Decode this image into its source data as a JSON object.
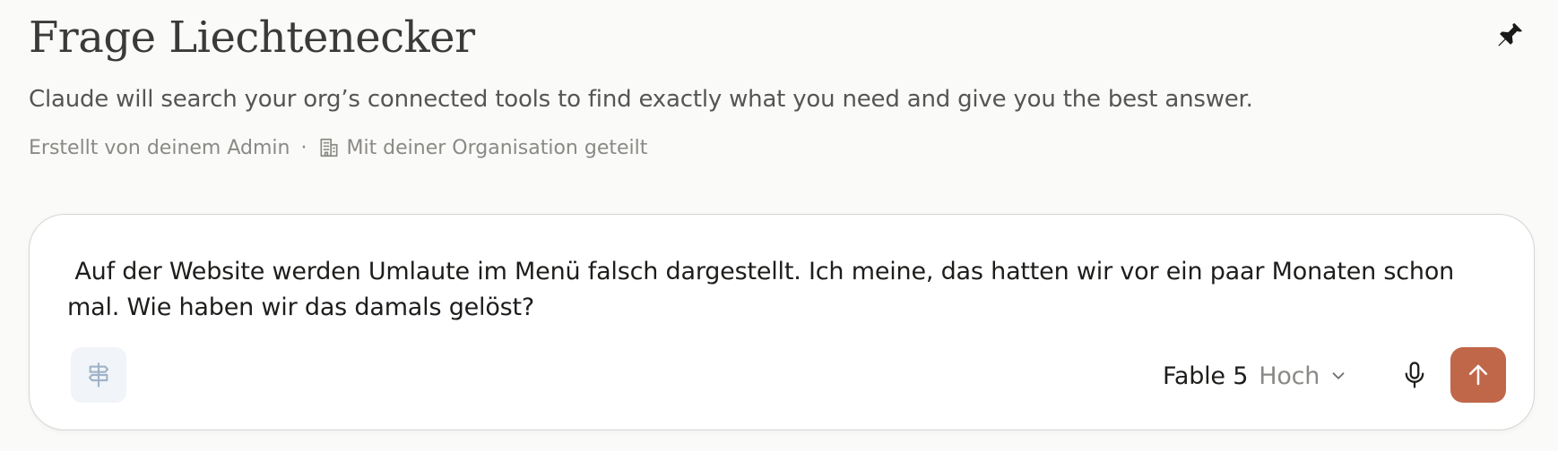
{
  "header": {
    "title": "Frage Liechtenecker",
    "subtitle": "Claude will search your org’s connected tools to find exactly what you need and give you the best answer.",
    "pin_icon": "pin-icon"
  },
  "meta": {
    "created_by": "Erstellt von deinem Admin",
    "separator": "·",
    "shared_icon": "building-icon",
    "shared_with": "Mit deiner Organisation geteilt"
  },
  "composer": {
    "message": " Auf der Website werden Umlaute im Menü falsch dargestellt. Ich meine, das hatten wir vor ein paar Monaten schon mal. Wie haben wir das damals gelöst?",
    "tool_icon": "signpost-icon",
    "model_name": "Fable 5",
    "model_effort": "Hoch",
    "chevron_icon": "chevron-down-icon",
    "mic_icon": "microphone-icon",
    "send_icon": "arrow-up-icon"
  },
  "colors": {
    "background": "#fafaf9",
    "send_button": "#c0674a",
    "tool_button_bg": "#f1f4f8",
    "muted_text": "#8a8985"
  }
}
